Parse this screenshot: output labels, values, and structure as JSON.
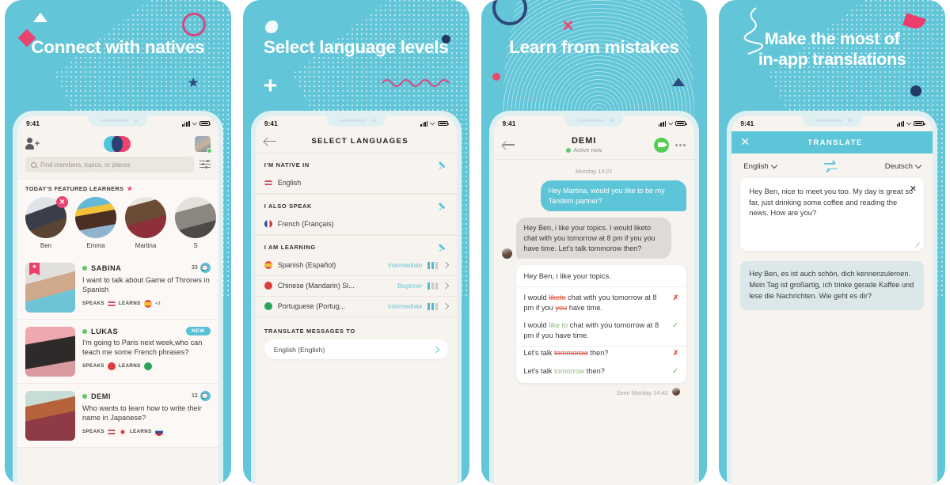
{
  "panels": [
    {
      "headline": "Connect with natives",
      "status": {
        "time": "9:41"
      },
      "topbar": {
        "add_icon": "add-user-icon",
        "logo": "tandem-logo",
        "avatar": "user-avatar"
      },
      "search": {
        "placeholder": "Find members, topics, or places",
        "filter_icon": "filter-icon"
      },
      "featured": {
        "title": "TODAY'S FEATURED LEARNERS",
        "star": "★",
        "items": [
          {
            "name": "Ben",
            "badge": "✕"
          },
          {
            "name": "Emma",
            "badge": ""
          },
          {
            "name": "Martina",
            "badge": ""
          },
          {
            "name": "S",
            "badge": ""
          }
        ]
      },
      "cards": [
        {
          "name": "SABINA",
          "count": "33",
          "badge_icon": "message-bubble-icon",
          "tag": "",
          "text": "I want to talk about Game of Thrones in Spanish",
          "speaks_label": "SPEAKS",
          "learns_label": "LEARNS",
          "speaks_flags": [
            "us"
          ],
          "learns_flags": [
            "es"
          ],
          "extra": "+3"
        },
        {
          "name": "LUKAS",
          "count": "",
          "badge_icon": "",
          "tag": "NEW",
          "text": "I'm going to Paris next week,who can teach me some French phrases?",
          "speaks_label": "SPEAKS",
          "learns_label": "LEARNS",
          "speaks_flags": [
            "jp"
          ],
          "learns_flags": [
            "br"
          ],
          "extra": ""
        },
        {
          "name": "DEMI",
          "count": "12",
          "badge_icon": "message-bubble-icon",
          "tag": "",
          "text": "Who wants to learn how to write their name in Japanese?",
          "speaks_label": "SPEAKS",
          "learns_label": "LEARNS",
          "speaks_flags": [
            "us",
            "jp"
          ],
          "learns_flags": [
            "ru"
          ],
          "extra": ""
        }
      ]
    },
    {
      "headline": "Select language levels",
      "status": {
        "time": "9:41"
      },
      "nav": {
        "title": "SELECT LANGUAGES",
        "back_icon": "back-arrow-icon"
      },
      "sections": [
        {
          "title": "I'M NATIVE IN",
          "edit_icon": "pencil-icon",
          "rows": [
            {
              "flag": "us",
              "name": "English",
              "level": "",
              "bars": 0
            }
          ]
        },
        {
          "title": "I ALSO SPEAK",
          "edit_icon": "pencil-icon",
          "rows": [
            {
              "flag": "fr",
              "name": "French (Français)",
              "level": "",
              "bars": 0
            }
          ]
        },
        {
          "title": "I AM LEARNING",
          "edit_icon": "pencil-icon",
          "rows": [
            {
              "flag": "es",
              "name": "Spanish (Español)",
              "level": "Intermediate",
              "bars": 2
            },
            {
              "flag": "cn",
              "name": "Chinese (Mandarin) Si...",
              "level": "Beginner",
              "bars": 1
            },
            {
              "flag": "br",
              "name": "Portuguese (Portug...",
              "level": "Intermediate",
              "bars": 2
            }
          ]
        }
      ],
      "translate_to": {
        "label": "TRANSLATE MESSAGES TO",
        "value": "English (English)"
      }
    },
    {
      "headline": "Learn from mistakes",
      "status": {
        "time": "9:41"
      },
      "nav": {
        "name": "DEMI",
        "status": "Active now",
        "back_icon": "back-arrow-icon",
        "video_icon": "video-call-icon",
        "more_icon": "more-options-icon"
      },
      "date_divider": "Monday 14:21",
      "outgoing": "Hey Martina, would you like to be my Tandem partner?",
      "incoming": "Hey Ben, i like your topics. I would liketo chat with you tomorrow at 8 pm if you you have time. Let's talk tommorow then?",
      "correction": {
        "original": "Hey Ben, i like your topics.",
        "lines": [
          {
            "pre": "I would ",
            "mark": "liketo",
            "mark_type": "strike",
            "post": " chat with you tomorrow at 8 pm if you ",
            "mark2": "you",
            "mark2_type": "strike",
            "post2": " have time.",
            "status": "x"
          },
          {
            "pre": "I would ",
            "mark": "like to",
            "mark_type": "fixed",
            "post": " chat with you tomorrow at 8 pm if you have time.",
            "mark2": "",
            "mark2_type": "",
            "post2": "",
            "status": "check"
          }
        ],
        "short_lines": [
          {
            "pre": "Let's talk ",
            "mark": "tommorow",
            "mark_type": "strike",
            "post": " then?",
            "status": "x"
          },
          {
            "pre": "Let's talk ",
            "mark": "tomorrow",
            "mark_type": "fixed",
            "post": " then?",
            "status": "check"
          }
        ]
      },
      "seen": "Seen Monday 14:43"
    },
    {
      "headline_line1": "Make the most of",
      "headline_line2": "in-app translations",
      "status": {
        "time": "9:41"
      },
      "nav": {
        "title": "TRANSLATE",
        "close_icon": "close-icon"
      },
      "source_lang": "English",
      "target_lang": "Deutsch",
      "swap_icon": "swap-languages-icon",
      "input_text": "Hey Ben, nice to meet you too. My day is great so far, just drinking some coffee and reading the news. How are you?",
      "clear_icon": "clear-icon",
      "output_text": "Hey Ben, es ist auch schön, dich kennenzulernen. Mein Tag ist großartig, ich trinke gerade Kaffee und lese die Nachrichten. Wie geht es dir?"
    }
  ],
  "colors": {
    "brand_teal": "#63c6d8",
    "accent_pink": "#ec4372",
    "navy": "#2c4a7c",
    "green": "#5fc96b",
    "error_red": "#e2503f",
    "success_green": "#7fb96a"
  }
}
